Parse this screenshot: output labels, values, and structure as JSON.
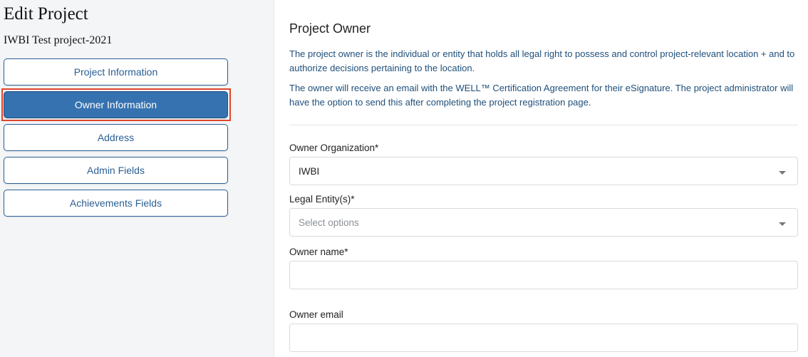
{
  "sidebar": {
    "page_title": "Edit Project",
    "project_name": "IWBI Test project-2021",
    "nav": [
      {
        "label": "Project Information"
      },
      {
        "label": "Owner Information"
      },
      {
        "label": "Address"
      },
      {
        "label": "Admin Fields"
      },
      {
        "label": "Achievements Fields"
      }
    ],
    "active_index": 1
  },
  "panel": {
    "title": "Project Owner",
    "description_1": "The project owner is the individual or entity that holds all legal right to possess and control project-relevant location + and to authorize decisions pertaining to the location.",
    "description_2": "The owner will receive an email with the WELL™ Certification Agreement for their eSignature. The project administrator will have the option to send this after completing the project registration page.",
    "fields": {
      "owner_organization": {
        "label": "Owner Organization*",
        "value": "IWBI"
      },
      "legal_entities": {
        "label": "Legal Entity(s)*",
        "placeholder": "Select options"
      },
      "owner_name": {
        "label": "Owner name*",
        "value": ""
      },
      "owner_email": {
        "label": "Owner email",
        "value": ""
      }
    }
  },
  "colors": {
    "accent": "#3672b0",
    "nav_border": "#2a5f93",
    "highlight": "#e0462c",
    "description_text": "#1f4f7a"
  }
}
